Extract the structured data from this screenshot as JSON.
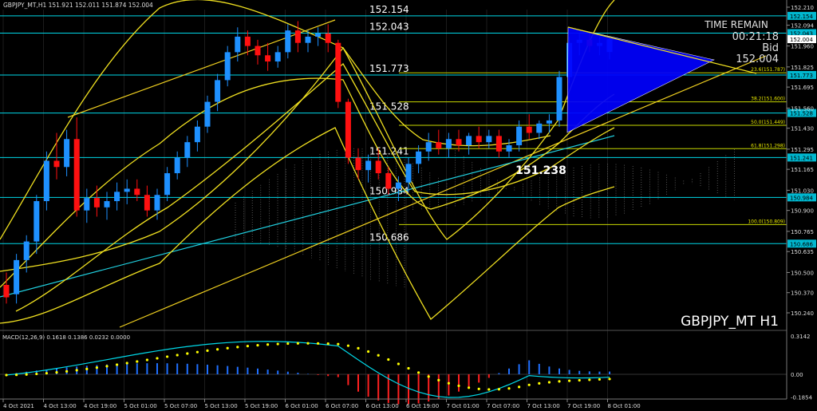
{
  "header": {
    "info": "GBPJPY_MT,H1  151.921 152.011 151.874 152.004"
  },
  "symbol_label": "GBPJPY_MT H1",
  "timer": {
    "title": "TIME REMAIN",
    "remaining": "00:21:18",
    "bid_label": "Bid",
    "bid_value": "152.004"
  },
  "low_marker": "151.238",
  "levels": [
    {
      "price": 152.154,
      "label": "152.154",
      "color": "#00d8e8"
    },
    {
      "price": 152.043,
      "label": "152.043",
      "color": "#00d8e8"
    },
    {
      "price": 151.773,
      "label": "151.773",
      "color": "#00d8e8"
    },
    {
      "price": 151.528,
      "label": "151.528",
      "color": "#00d8e8"
    },
    {
      "price": 151.241,
      "label": "151.241",
      "color": "#00d8e8"
    },
    {
      "price": 150.984,
      "label": "150.984",
      "color": "#00d8e8"
    },
    {
      "price": 150.686,
      "label": "150.686",
      "color": "#00d8e8"
    }
  ],
  "fib": [
    {
      "price": 151.787,
      "label": "23.6(151.787)"
    },
    {
      "price": 151.6,
      "label": "38.2(151.600)"
    },
    {
      "price": 151.449,
      "label": "50.0(151.449)"
    },
    {
      "price": 151.298,
      "label": "61.8(151.298)"
    },
    {
      "price": 150.809,
      "label": "100.0(150.809)"
    }
  ],
  "price_axis": [
    "152.210",
    "152.094",
    "151.960",
    "151.825",
    "151.695",
    "151.560",
    "151.430",
    "151.295",
    "151.165",
    "151.030",
    "150.900",
    "150.765",
    "150.635",
    "150.500",
    "150.370",
    "150.240"
  ],
  "current_price_tag": "152.004",
  "macd": {
    "label": "MACD(12,26,9) 0.1618 0.1386 0.0232 0.0000",
    "axis": [
      "0.3142",
      "0.00",
      "-0.1854"
    ]
  },
  "time_axis": [
    "4 Oct 2021",
    "4 Oct 13:00",
    "4 Oct 19:00",
    "5 Oct 01:00",
    "5 Oct 07:00",
    "5 Oct 13:00",
    "5 Oct 19:00",
    "6 Oct 01:00",
    "6 Oct 07:00",
    "6 Oct 13:00",
    "6 Oct 19:00",
    "7 Oct 01:00",
    "7 Oct 07:00",
    "7 Oct 13:00",
    "7 Oct 19:00",
    "8 Oct 01:00"
  ],
  "colors": {
    "bull": "#1e90ff",
    "bear": "#ff1010",
    "level": "#00d8e8",
    "fib": "#c8d800",
    "bands": "#f0e020",
    "triangle": "#0000ff",
    "signal": "#ffff00",
    "macd_line": "#00d8e8",
    "grid": "#1c1c1c"
  },
  "candles": [
    [
      150.42,
      150.5,
      150.3,
      150.34
    ],
    [
      150.36,
      150.62,
      150.3,
      150.58
    ],
    [
      150.58,
      150.74,
      150.5,
      150.7
    ],
    [
      150.7,
      151.0,
      150.62,
      150.96
    ],
    [
      150.96,
      151.28,
      150.9,
      151.22
    ],
    [
      151.22,
      151.4,
      151.1,
      151.18
    ],
    [
      151.18,
      151.42,
      151.12,
      151.36
    ],
    [
      151.36,
      151.5,
      150.86,
      150.9
    ],
    [
      150.9,
      151.04,
      150.82,
      150.98
    ],
    [
      150.98,
      151.06,
      150.86,
      150.92
    ],
    [
      150.92,
      151.02,
      150.84,
      150.96
    ],
    [
      150.96,
      151.08,
      150.9,
      151.02
    ],
    [
      151.02,
      151.1,
      150.94,
      151.04
    ],
    [
      151.04,
      151.1,
      150.96,
      151.0
    ],
    [
      151.0,
      151.06,
      150.86,
      150.9
    ],
    [
      150.9,
      151.04,
      150.84,
      151.0
    ],
    [
      151.0,
      151.18,
      150.96,
      151.14
    ],
    [
      151.14,
      151.28,
      151.1,
      151.24
    ],
    [
      151.24,
      151.38,
      151.18,
      151.34
    ],
    [
      151.34,
      151.48,
      151.28,
      151.44
    ],
    [
      151.44,
      151.64,
      151.4,
      151.6
    ],
    [
      151.6,
      151.78,
      151.54,
      151.74
    ],
    [
      151.74,
      151.96,
      151.7,
      151.92
    ],
    [
      151.92,
      152.08,
      151.86,
      152.02
    ],
    [
      152.02,
      152.06,
      151.9,
      151.96
    ],
    [
      151.96,
      152.0,
      151.84,
      151.9
    ],
    [
      151.9,
      151.98,
      151.8,
      151.86
    ],
    [
      151.86,
      151.96,
      151.82,
      151.92
    ],
    [
      151.92,
      152.1,
      151.88,
      152.06
    ],
    [
      152.06,
      152.12,
      151.92,
      151.98
    ],
    [
      151.98,
      152.06,
      151.92,
      152.02
    ],
    [
      152.02,
      152.08,
      151.96,
      152.04
    ],
    [
      152.04,
      152.1,
      151.92,
      151.98
    ],
    [
      151.98,
      152.0,
      151.56,
      151.6
    ],
    [
      151.6,
      151.62,
      151.2,
      151.24
    ],
    [
      151.24,
      151.3,
      151.1,
      151.16
    ],
    [
      151.16,
      151.26,
      151.08,
      151.22
    ],
    [
      151.22,
      151.3,
      151.1,
      151.14
    ],
    [
      151.14,
      151.18,
      151.0,
      151.04
    ],
    [
      151.04,
      151.12,
      150.96,
      151.08
    ],
    [
      151.08,
      151.24,
      151.02,
      151.2
    ],
    [
      151.2,
      151.32,
      151.14,
      151.28
    ],
    [
      151.28,
      151.4,
      151.22,
      151.34
    ],
    [
      151.34,
      151.42,
      151.26,
      151.3
    ],
    [
      151.3,
      151.4,
      151.24,
      151.36
    ],
    [
      151.36,
      151.42,
      151.28,
      151.32
    ],
    [
      151.32,
      151.4,
      151.26,
      151.38
    ],
    [
      151.38,
      151.44,
      151.3,
      151.34
    ],
    [
      151.34,
      151.42,
      151.3,
      151.38
    ],
    [
      151.38,
      151.42,
      151.24,
      151.28
    ],
    [
      151.28,
      151.36,
      151.24,
      151.32
    ],
    [
      151.32,
      151.48,
      151.28,
      151.44
    ],
    [
      151.44,
      151.52,
      151.36,
      151.4
    ],
    [
      151.4,
      151.48,
      151.36,
      151.46
    ],
    [
      151.46,
      151.52,
      151.4,
      151.48
    ],
    [
      151.48,
      151.8,
      151.44,
      151.76
    ],
    [
      151.76,
      152.02,
      151.72,
      151.98
    ],
    [
      151.98,
      152.04,
      151.9,
      152.0
    ],
    [
      152.0,
      152.04,
      151.92,
      151.96
    ],
    [
      151.96,
      152.02,
      151.9,
      151.98
    ],
    [
      151.921,
      152.011,
      151.874,
      152.004
    ]
  ]
}
